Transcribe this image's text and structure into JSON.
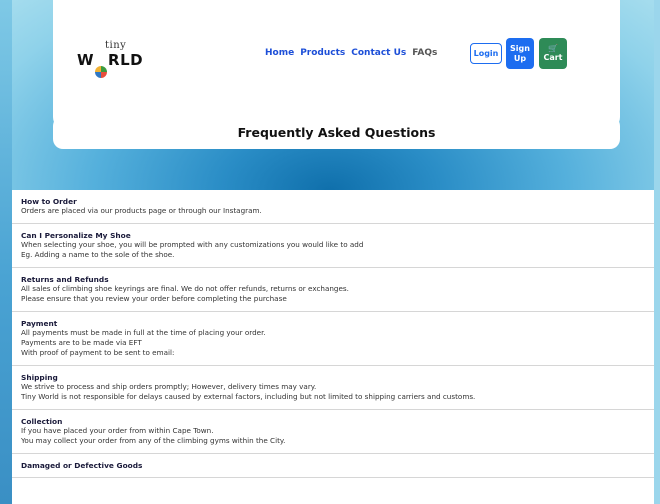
{
  "brand": {
    "logo_top": "tiny",
    "logo_bottom_prefix": "W",
    "logo_bottom_o": "O",
    "logo_bottom_suffix": "RLD"
  },
  "nav": {
    "items": [
      "Home",
      "Products",
      "Contact Us",
      "FAQs"
    ]
  },
  "actions": {
    "login": "Login",
    "signup_line1": "Sign",
    "signup_line2": "Up",
    "cart_icon": "🛒",
    "cart": "Cart"
  },
  "page": {
    "title": "Frequently Asked Questions"
  },
  "faqs": [
    {
      "question": "How to Order",
      "answer": [
        "Orders are placed via our products page or through our Instagram."
      ]
    },
    {
      "question": "Can I Personalize My Shoe",
      "answer": [
        "When selecting your shoe, you will be prompted with any customizations you would like to add",
        "Eg. Adding a name to the sole of the shoe."
      ]
    },
    {
      "question": "Returns and Refunds",
      "answer": [
        "All sales of climbing shoe keyrings are final. We do not offer refunds, returns or exchanges.",
        "Please ensure that you review your order before completing the purchase"
      ]
    },
    {
      "question": "Payment",
      "answer": [
        "All payments must be made in full at the time of placing your order.",
        "Payments are to be made via EFT",
        "With proof of payment to be sent to email:"
      ]
    },
    {
      "question": "Shipping",
      "answer": [
        "We strive to process and ship orders promptly; However, delivery times may vary.",
        "Tiny World is not responsible for delays caused by external factors, including but not limited to shipping carriers and customs."
      ]
    },
    {
      "question": "Collection",
      "answer": [
        "If you have placed your order from within Cape Town.",
        "You may collect your order from any of the climbing gyms within the City."
      ]
    },
    {
      "question": "Damaged or Defective Goods",
      "answer": []
    }
  ]
}
